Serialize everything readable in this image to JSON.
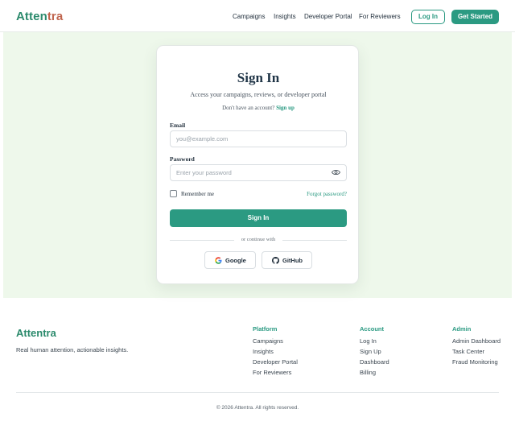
{
  "brand": {
    "name_part1": "Atten",
    "name_part2": "tra",
    "footer_name": "Attentra"
  },
  "nav": {
    "items": [
      "Campaigns",
      "Insights",
      "Developer Portal",
      "For Reviewers"
    ],
    "login_label": "Log In",
    "get_started_label": "Get Started"
  },
  "signin": {
    "title": "Sign In",
    "subtitle": "Access your campaigns, reviews, or developer portal",
    "no_account_text": "Don't have an account?",
    "signup_link": "Sign up",
    "email_label": "Email",
    "email_placeholder": "you@example.com",
    "password_label": "Password",
    "password_placeholder": "Enter your password",
    "remember_label": "Remember me",
    "forgot_label": "Forgot password?",
    "submit_label": "Sign In",
    "divider_text": "or continue with",
    "google_label": "Google",
    "github_label": "GitHub"
  },
  "footer": {
    "tagline": "Real human attention, actionable insights.",
    "columns": [
      {
        "heading": "Platform",
        "items": [
          "Campaigns",
          "Insights",
          "Developer Portal",
          "For Reviewers"
        ]
      },
      {
        "heading": "Account",
        "items": [
          "Log In",
          "Sign Up",
          "Dashboard",
          "Billing"
        ]
      },
      {
        "heading": "Admin",
        "items": [
          "Admin Dashboard",
          "Task Center",
          "Fraud Monitoring"
        ]
      }
    ],
    "copyright": "© 2026 Attentra. All rights reserved."
  },
  "colors": {
    "accent": "#2b9a82",
    "brand_green": "#2b8a6c",
    "brand_orange": "#c0654e",
    "hero_bg": "#eef8eb"
  },
  "icons": {
    "password_toggle": "eye-icon",
    "google": "google-icon",
    "github": "github-icon"
  }
}
